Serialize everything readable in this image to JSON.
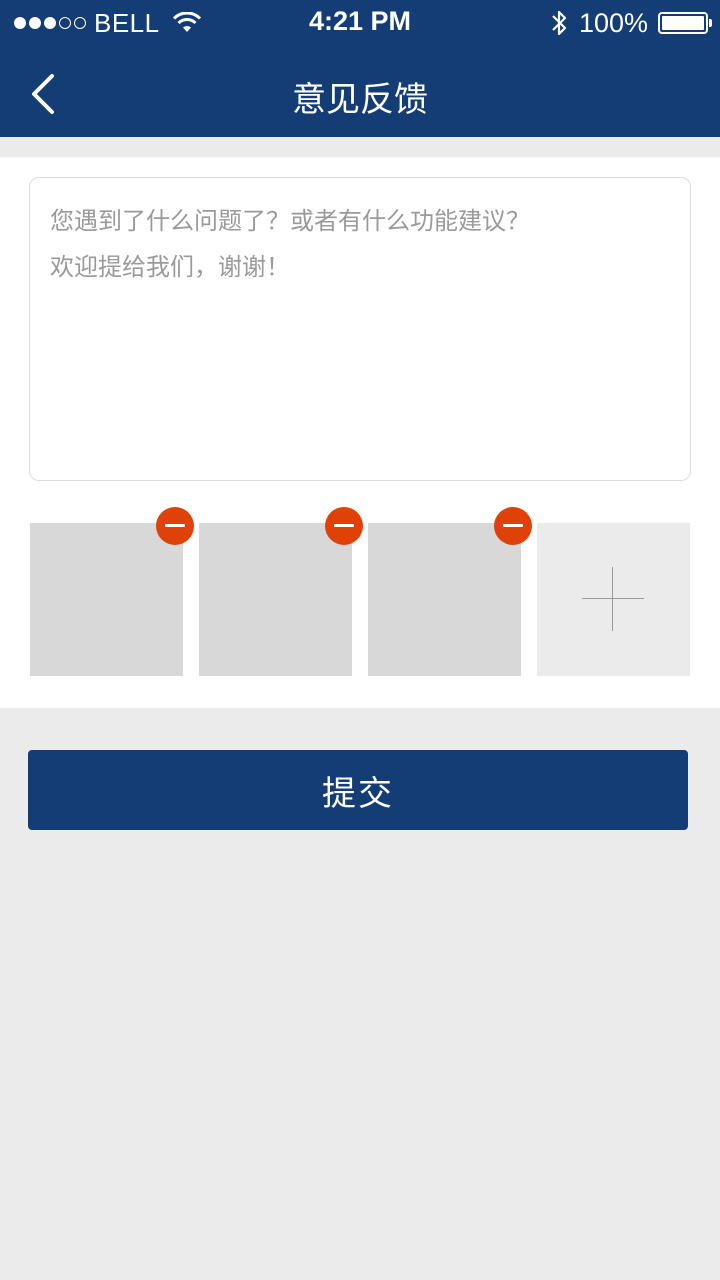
{
  "status_bar": {
    "carrier": "BELL",
    "time": "4:21 PM",
    "battery_percent": "100%",
    "signal_bars_filled": 3,
    "signal_bars_total": 5
  },
  "nav": {
    "title": "意见反馈",
    "back_icon": "chevron-left-icon"
  },
  "feedback": {
    "placeholder": "您遇到了什么问题了？或者有什么功能建议？\n欢迎提给我们，谢谢！",
    "value": ""
  },
  "photos": {
    "thumbnails": 3,
    "remove_icon": "minus-circle-icon",
    "add_icon": "plus-icon"
  },
  "submit": {
    "label": "提交"
  },
  "colors": {
    "primary": "#143d76",
    "remove": "#df4107",
    "background": "#ebebeb"
  }
}
